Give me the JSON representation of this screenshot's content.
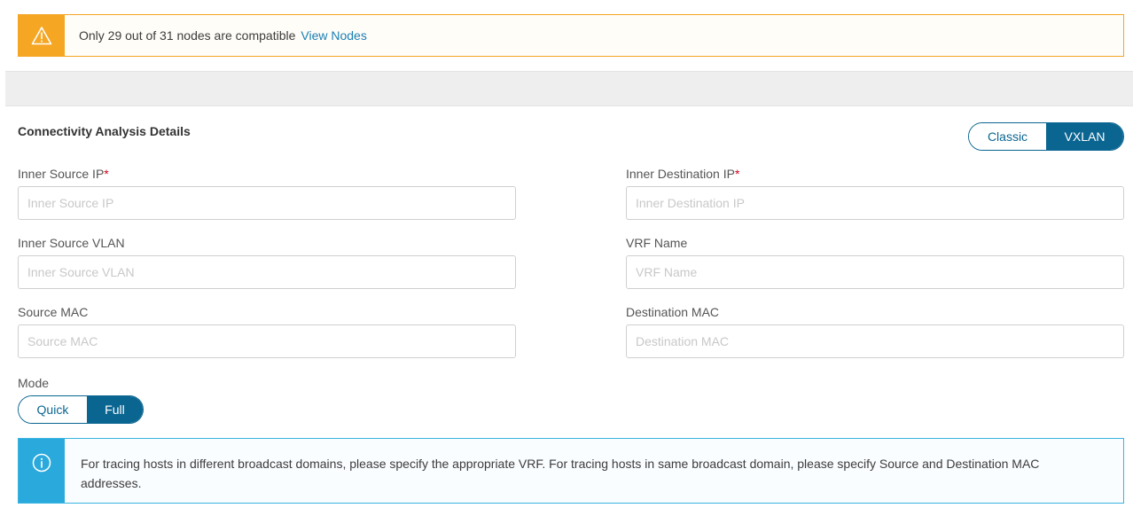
{
  "warning": {
    "message": "Only 29 out of 31 nodes are compatible",
    "link": "View Nodes",
    "color": "#f5a623"
  },
  "section": {
    "title": "Connectivity Analysis Details"
  },
  "type_toggle": {
    "options": [
      "Classic",
      "VXLAN"
    ],
    "selected": "VXLAN"
  },
  "fields": {
    "inner_source_ip": {
      "label": "Inner Source IP",
      "required_mark": "*",
      "placeholder": "Inner Source IP",
      "value": ""
    },
    "inner_destination_ip": {
      "label": "Inner Destination IP",
      "required_mark": "*",
      "placeholder": "Inner Destination IP",
      "value": ""
    },
    "inner_source_vlan": {
      "label": "Inner Source VLAN",
      "placeholder": "Inner Source VLAN",
      "value": ""
    },
    "vrf_name": {
      "label": "VRF Name",
      "placeholder": "VRF Name",
      "value": ""
    },
    "source_mac": {
      "label": "Source MAC",
      "placeholder": "Source MAC",
      "value": ""
    },
    "destination_mac": {
      "label": "Destination MAC",
      "placeholder": "Destination MAC",
      "value": ""
    }
  },
  "mode": {
    "label": "Mode",
    "options": [
      "Quick",
      "Full"
    ],
    "selected": "Full"
  },
  "info": {
    "message": "For tracing hosts in different broadcast domains, please specify the appropriate VRF. For tracing hosts in same broadcast domain, please specify Source and Destination MAC addresses.",
    "color": "#2aa9dc"
  },
  "accent_color": "#0a6591"
}
